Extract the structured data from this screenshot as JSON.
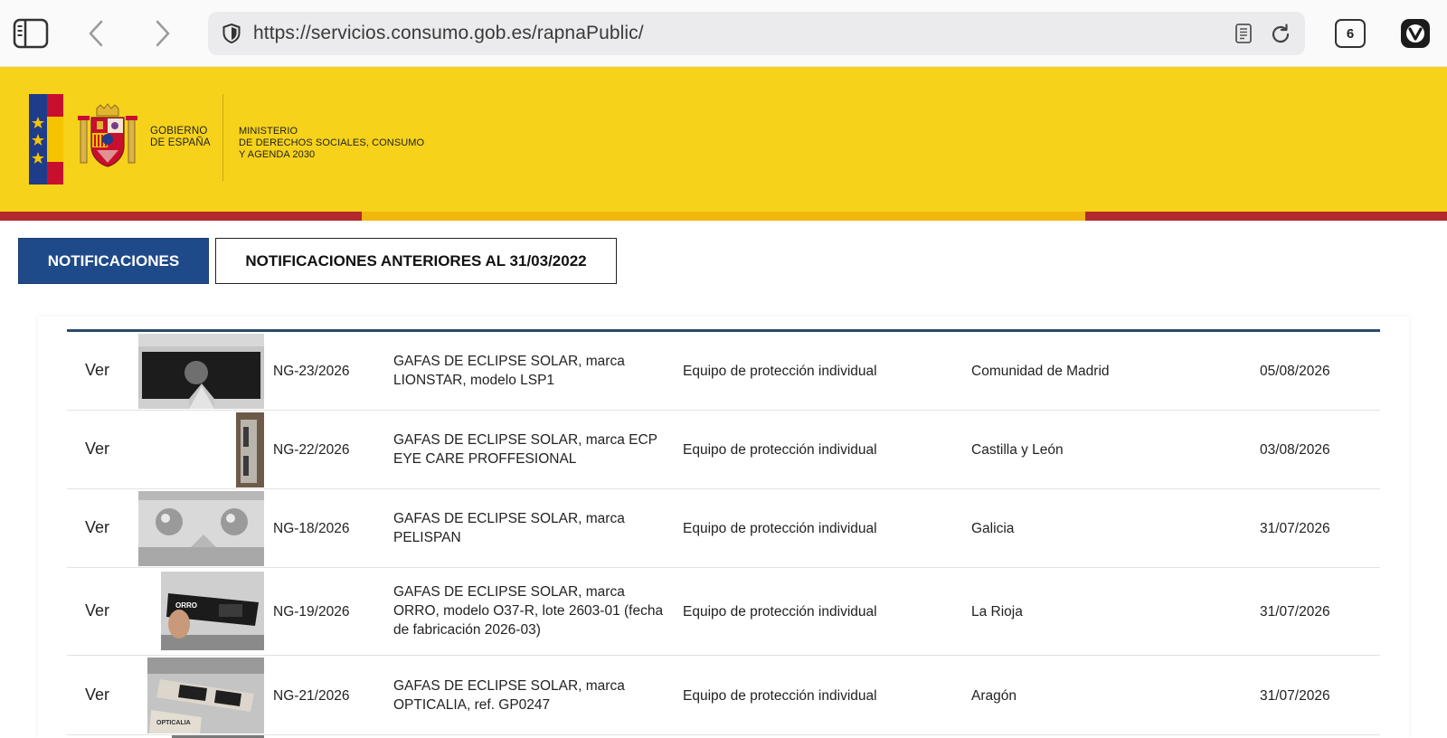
{
  "browser": {
    "url": "https://servicios.consumo.gob.es/rapnaPublic/",
    "tab_count": "6",
    "icons": [
      "sidebar-icon",
      "back-icon",
      "forward-icon",
      "shield-icon",
      "reader-icon",
      "reload-icon",
      "vivaldi-icon"
    ]
  },
  "header": {
    "gov_line1": "GOBIERNO",
    "gov_line2": "DE ESPAÑA",
    "ministry_line1": "MINISTERIO",
    "ministry_line2": "DE DERECHOS SOCIALES, CONSUMO",
    "ministry_line3": "Y AGENDA 2030",
    "colors": {
      "yellow": "#f6d21b",
      "red": "#b3282d",
      "blue": "#1f4a8a"
    }
  },
  "tabs": {
    "active_label": "NOTIFICACIONES",
    "other_label": "NOTIFICACIONES ANTERIORES AL 31/03/2022"
  },
  "rows": [
    {
      "ver": "Ver",
      "code": "NG-23/2026",
      "desc_l1": "GAFAS DE ECLIPSE SOLAR, marca",
      "desc_l2": "LIONSTAR, modelo LSP1",
      "desc_l3": "",
      "category": "Equipo de protección individual",
      "region": "Comunidad de Madrid",
      "date": "05/08/2026"
    },
    {
      "ver": "Ver",
      "code": "NG-22/2026",
      "desc_l1": "GAFAS DE ECLIPSE SOLAR, marca ECP",
      "desc_l2": "EYE CARE PROFFESIONAL",
      "desc_l3": "",
      "category": "Equipo de protección individual",
      "region": "Castilla y León",
      "date": "03/08/2026"
    },
    {
      "ver": "Ver",
      "code": "NG-18/2026",
      "desc_l1": "GAFAS DE ECLIPSE SOLAR, marca",
      "desc_l2": "PELISPAN",
      "desc_l3": "",
      "category": "Equipo de protección individual",
      "region": "Galicia",
      "date": "31/07/2026"
    },
    {
      "ver": "Ver",
      "code": "NG-19/2026",
      "desc_l1": "GAFAS DE ECLIPSE SOLAR, marca",
      "desc_l2": "ORRO, modelo O37-R, lote 2603-01 (fecha",
      "desc_l3": "de fabricación 2026-03)",
      "category": "Equipo de protección individual",
      "region": "La Rioja",
      "date": "31/07/2026"
    },
    {
      "ver": "Ver",
      "code": "NG-21/2026",
      "desc_l1": "GAFAS DE ECLIPSE SOLAR, marca",
      "desc_l2": "OPTICALIA, ref. GP0247",
      "desc_l3": "",
      "category": "Equipo de protección individual",
      "region": "Aragón",
      "date": "31/07/2026"
    }
  ],
  "thumb_texts": {
    "orro": "ORRO",
    "opticalia": "OPTICALIA"
  }
}
